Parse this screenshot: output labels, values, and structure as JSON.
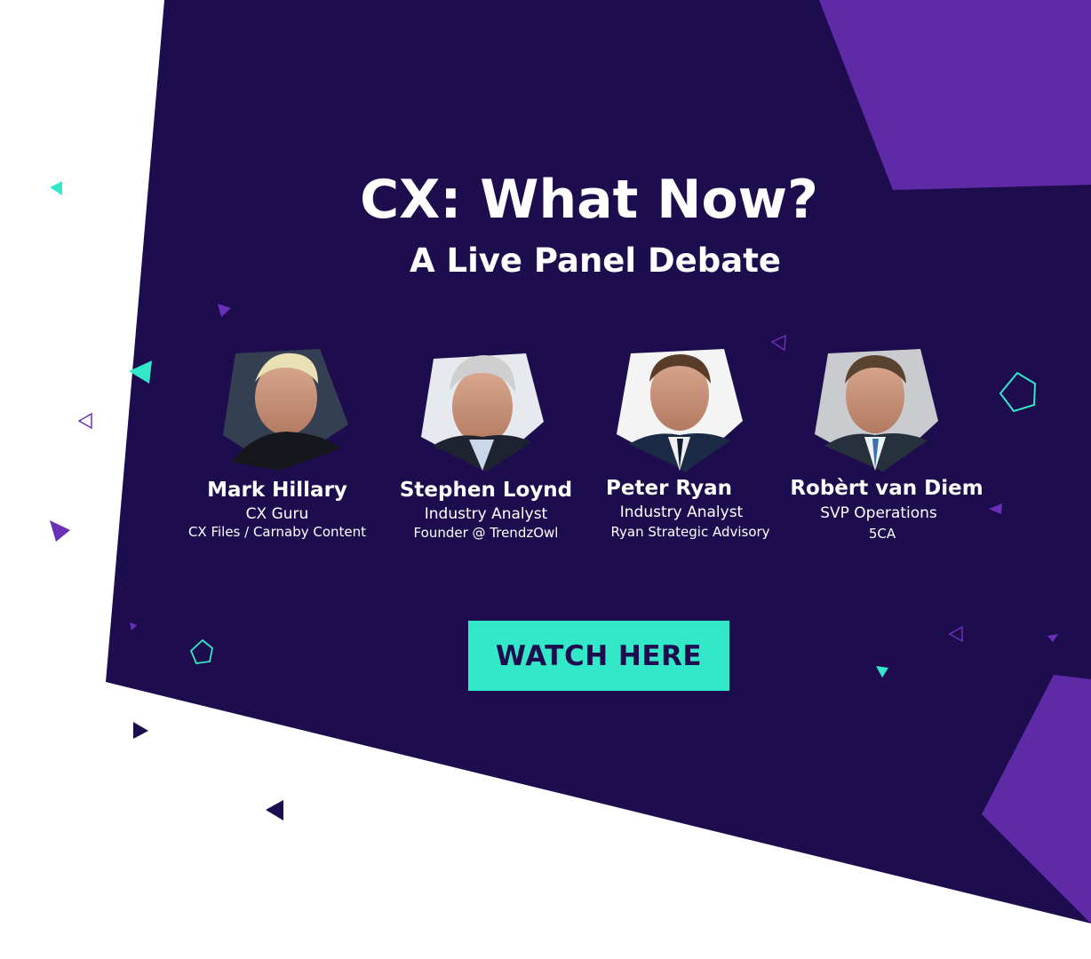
{
  "colors": {
    "panel": "#1e0d4e",
    "accent_purple": "#5f2aa6",
    "cta": "#33e8c8",
    "cta_text": "#1e0d4e",
    "teal": "#33e8c8",
    "violet": "#6b2fb8"
  },
  "header": {
    "title": "CX: What Now?",
    "subtitle": "A Live Panel Debate"
  },
  "speakers": [
    {
      "name": "Mark Hillary",
      "role": "CX Guru",
      "org": "CX Files / Carnaby Content",
      "photo": "speaker-photo"
    },
    {
      "name": "Stephen Loynd",
      "role": "Industry Analyst",
      "org": "Founder @ TrendzOwl",
      "photo": "speaker-photo"
    },
    {
      "name": "Peter Ryan",
      "role": "Industry Analyst",
      "org": "Ryan Strategic Advisory",
      "photo": "speaker-photo"
    },
    {
      "name": "Robèrt van Diem",
      "role": "SVP Operations",
      "org": "5CA",
      "photo": "speaker-photo"
    }
  ],
  "cta": {
    "label": "WATCH HERE"
  }
}
